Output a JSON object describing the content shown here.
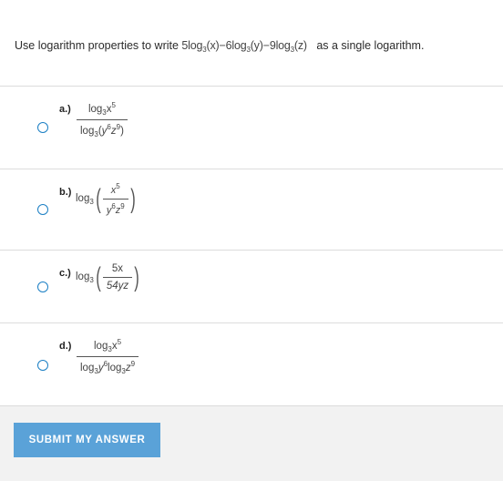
{
  "question": {
    "prefix": "Use logarithm properties to write ",
    "expr": {
      "c1": "5",
      "c2": "6",
      "c3": "9",
      "log": "log",
      "base": "3",
      "x": "(x)",
      "y": "(y)",
      "z": "(z)",
      "minus": "−"
    },
    "suffix": "as a single logarithm."
  },
  "options": [
    {
      "label": "a.)",
      "num_log": "log",
      "num_base": "3",
      "num_var": "x",
      "num_exp": "5",
      "den_log": "log",
      "den_base": "3",
      "den_open": "(",
      "den_y": "y",
      "den_yexp": "6",
      "den_z": "z",
      "den_zexp": "9",
      "den_close": ")"
    },
    {
      "label": "b.)",
      "log": "log",
      "base": "3",
      "num_var": "x",
      "num_exp": "5",
      "den_y": "y",
      "den_yexp": "6",
      "den_z": "z",
      "den_zexp": "9"
    },
    {
      "label": "c.)",
      "log": "log",
      "base": "3",
      "num": "5x",
      "den": "54yz"
    },
    {
      "label": "d.)",
      "num_log": "log",
      "num_base": "3",
      "num_var": "x",
      "num_exp": "5",
      "den_log1": "log",
      "den_base1": "3",
      "den_y": "y",
      "den_yexp": "6",
      "den_log2": "log",
      "den_base2": "3",
      "den_z": "z",
      "den_zexp": "9"
    }
  ],
  "submit": {
    "label": "SUBMIT MY ANSWER"
  }
}
